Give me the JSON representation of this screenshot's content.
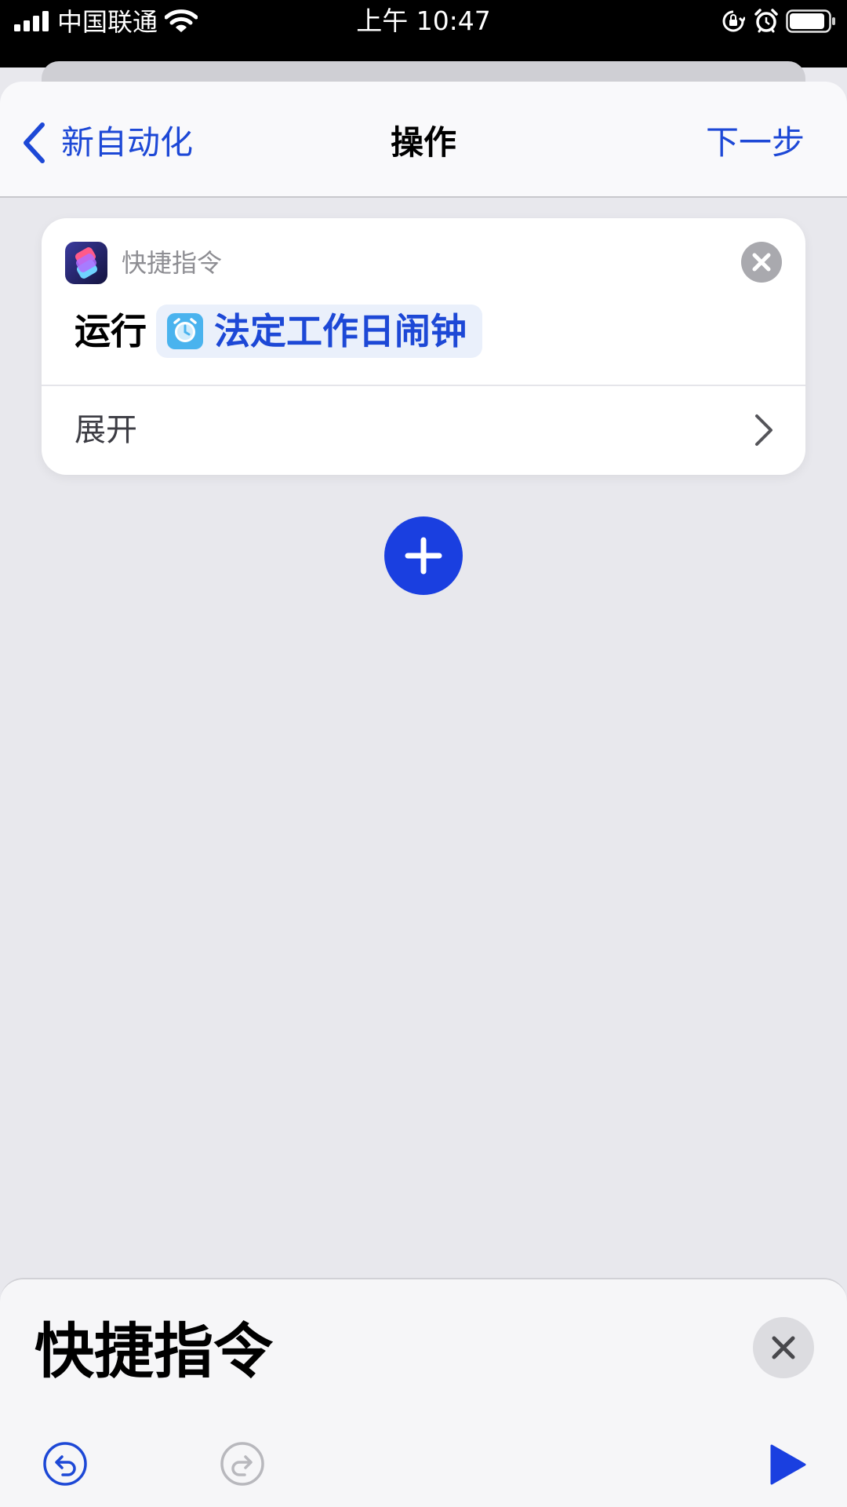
{
  "status_bar": {
    "carrier": "中国联通",
    "time": "上午 10:47",
    "icons": [
      "signal-icon",
      "wifi-icon",
      "orientation-lock-icon",
      "alarm-icon",
      "battery-icon"
    ]
  },
  "nav": {
    "back_label": "新自动化",
    "title": "操作",
    "next_label": "下一步"
  },
  "action": {
    "app_name": "快捷指令",
    "run_label": "运行",
    "shortcut_name": "法定工作日闹钟",
    "expand_label": "展开"
  },
  "bottom_panel": {
    "title": "快捷指令"
  },
  "colors": {
    "accent": "#1d48d6",
    "add_button": "#1a3fe0",
    "background": "#e8e8ed",
    "chip_background": "#eaf0fb",
    "chip_icon": "#4ab3ee"
  }
}
